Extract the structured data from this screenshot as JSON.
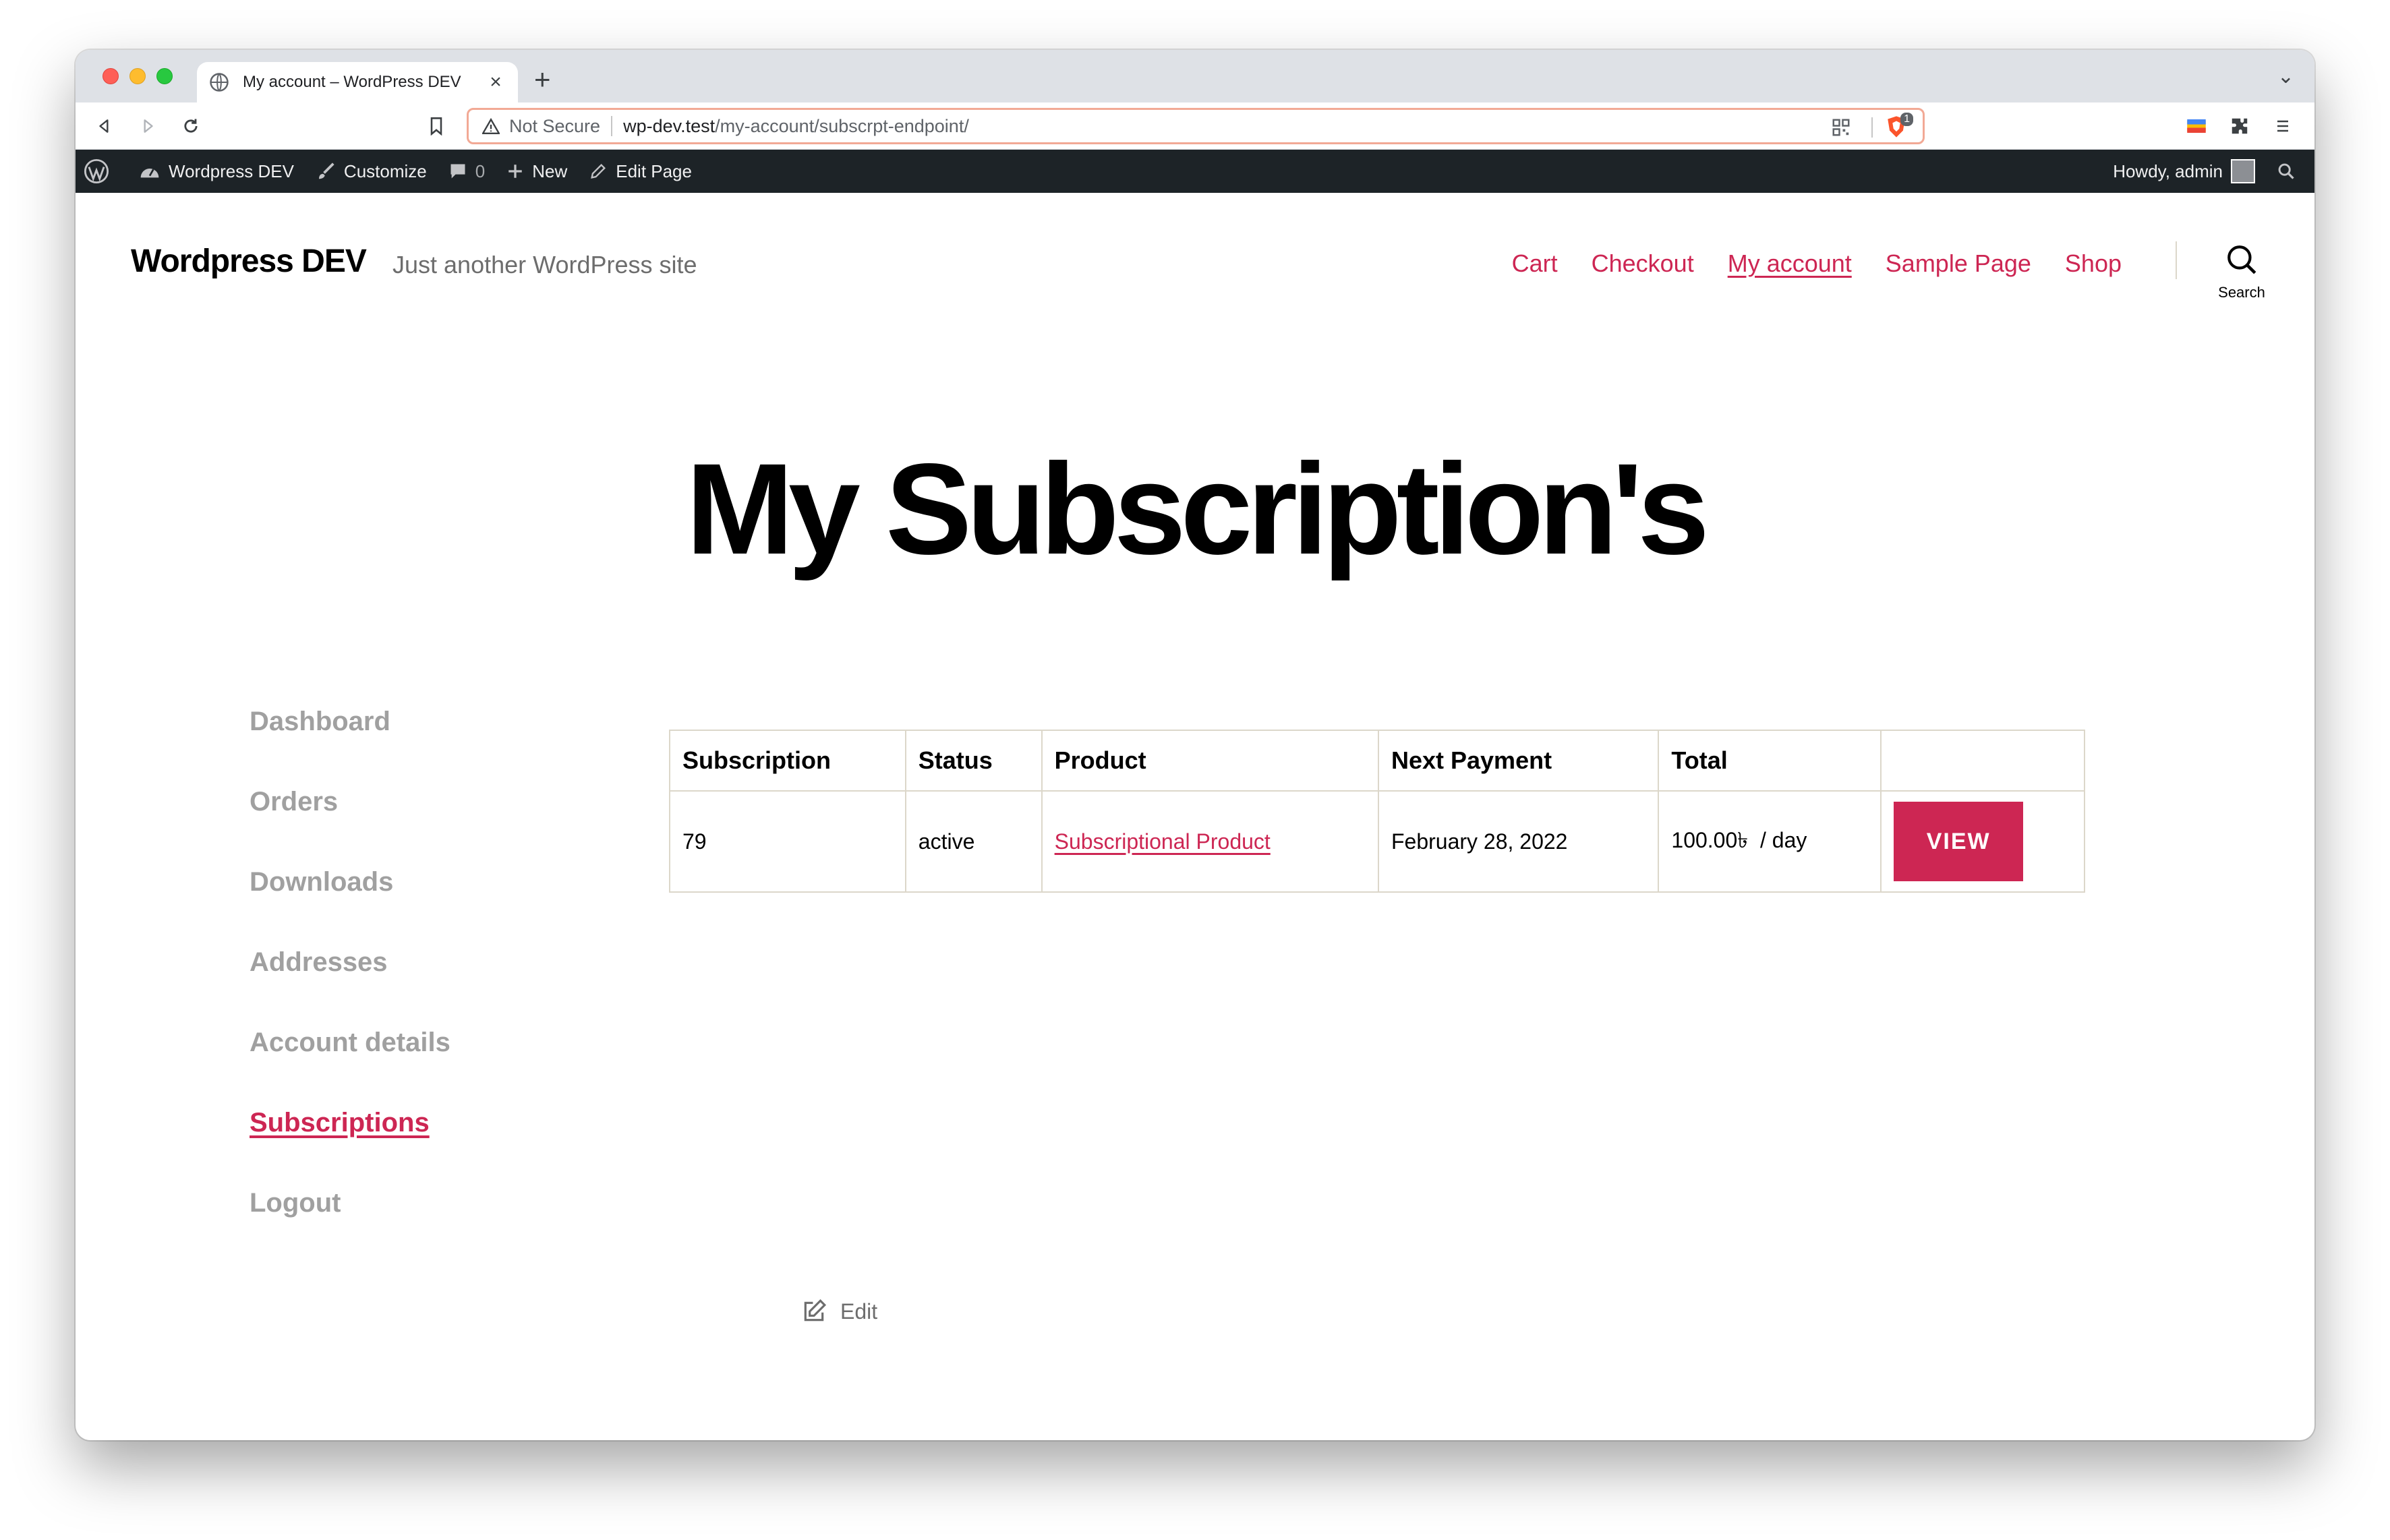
{
  "browser": {
    "tab_title": "My account – WordPress DEV",
    "new_tab": "+",
    "omnibox": {
      "security_label": "Not Secure",
      "url_host": "wp-dev.test",
      "url_path": "/my-account/subscrpt-endpoint/"
    },
    "shield_badge": "1"
  },
  "adminbar": {
    "site_name": "Wordpress DEV",
    "customize": "Customize",
    "comments_count": "0",
    "new": "New",
    "edit_page": "Edit Page",
    "howdy": "Howdy, admin"
  },
  "site": {
    "title": "Wordpress DEV",
    "description": "Just another WordPress site",
    "menu": [
      "Cart",
      "Checkout",
      "My account",
      "Sample Page",
      "Shop"
    ],
    "search_label": "Search"
  },
  "page": {
    "title": "My Subscription's"
  },
  "account_nav": [
    "Dashboard",
    "Orders",
    "Downloads",
    "Addresses",
    "Account details",
    "Subscriptions",
    "Logout"
  ],
  "table": {
    "headers": [
      "Subscription",
      "Status",
      "Product",
      "Next Payment",
      "Total",
      ""
    ],
    "rows": [
      {
        "subscription": "79",
        "status": "active",
        "product": "Subscriptional Product",
        "next_payment": "February 28, 2022",
        "total": "100.00৳  / day",
        "action": "VIEW"
      }
    ]
  },
  "edit_label": "Edit",
  "colors": {
    "accent": "#cd2653",
    "adminbar": "#1d2327",
    "muted": "#a0a0a0"
  }
}
